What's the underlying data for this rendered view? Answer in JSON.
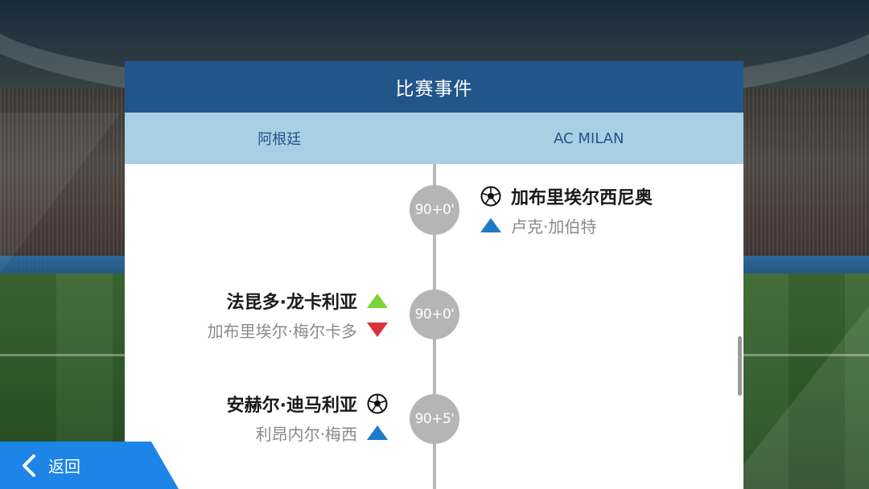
{
  "header": {
    "title": "比赛事件"
  },
  "teams": {
    "home": "阿根廷",
    "away": "AC MILAN"
  },
  "events": [
    {
      "time": "90+0'",
      "side": "away",
      "primary": {
        "text": "加布里埃尔西尼奥",
        "icon": "soccer-ball-icon"
      },
      "secondary": {
        "text": "卢克·加伯特",
        "icon": "assist-up-icon",
        "color": "#1e7ac8"
      }
    },
    {
      "time": "90+0'",
      "side": "home",
      "primary": {
        "text": "法昆多·龙卡利亚",
        "icon": "substitution-in-icon",
        "color": "#7bd33a"
      },
      "secondary": {
        "text": "加布里埃尔·梅尔卡多",
        "icon": "substitution-out-icon",
        "color": "#d9333a"
      }
    },
    {
      "time": "90+5'",
      "side": "home",
      "primary": {
        "text": "安赫尔·迪马利亚",
        "icon": "soccer-ball-icon"
      },
      "secondary": {
        "text": "利昂内尔·梅西",
        "icon": "assist-up-icon",
        "color": "#1e7ac8"
      }
    }
  ],
  "footer": {
    "back_label": "返回"
  },
  "colors": {
    "header_bg": "#22568a",
    "team_bar_bg": "#a9cfe4",
    "back_button": "#1d85e8"
  }
}
